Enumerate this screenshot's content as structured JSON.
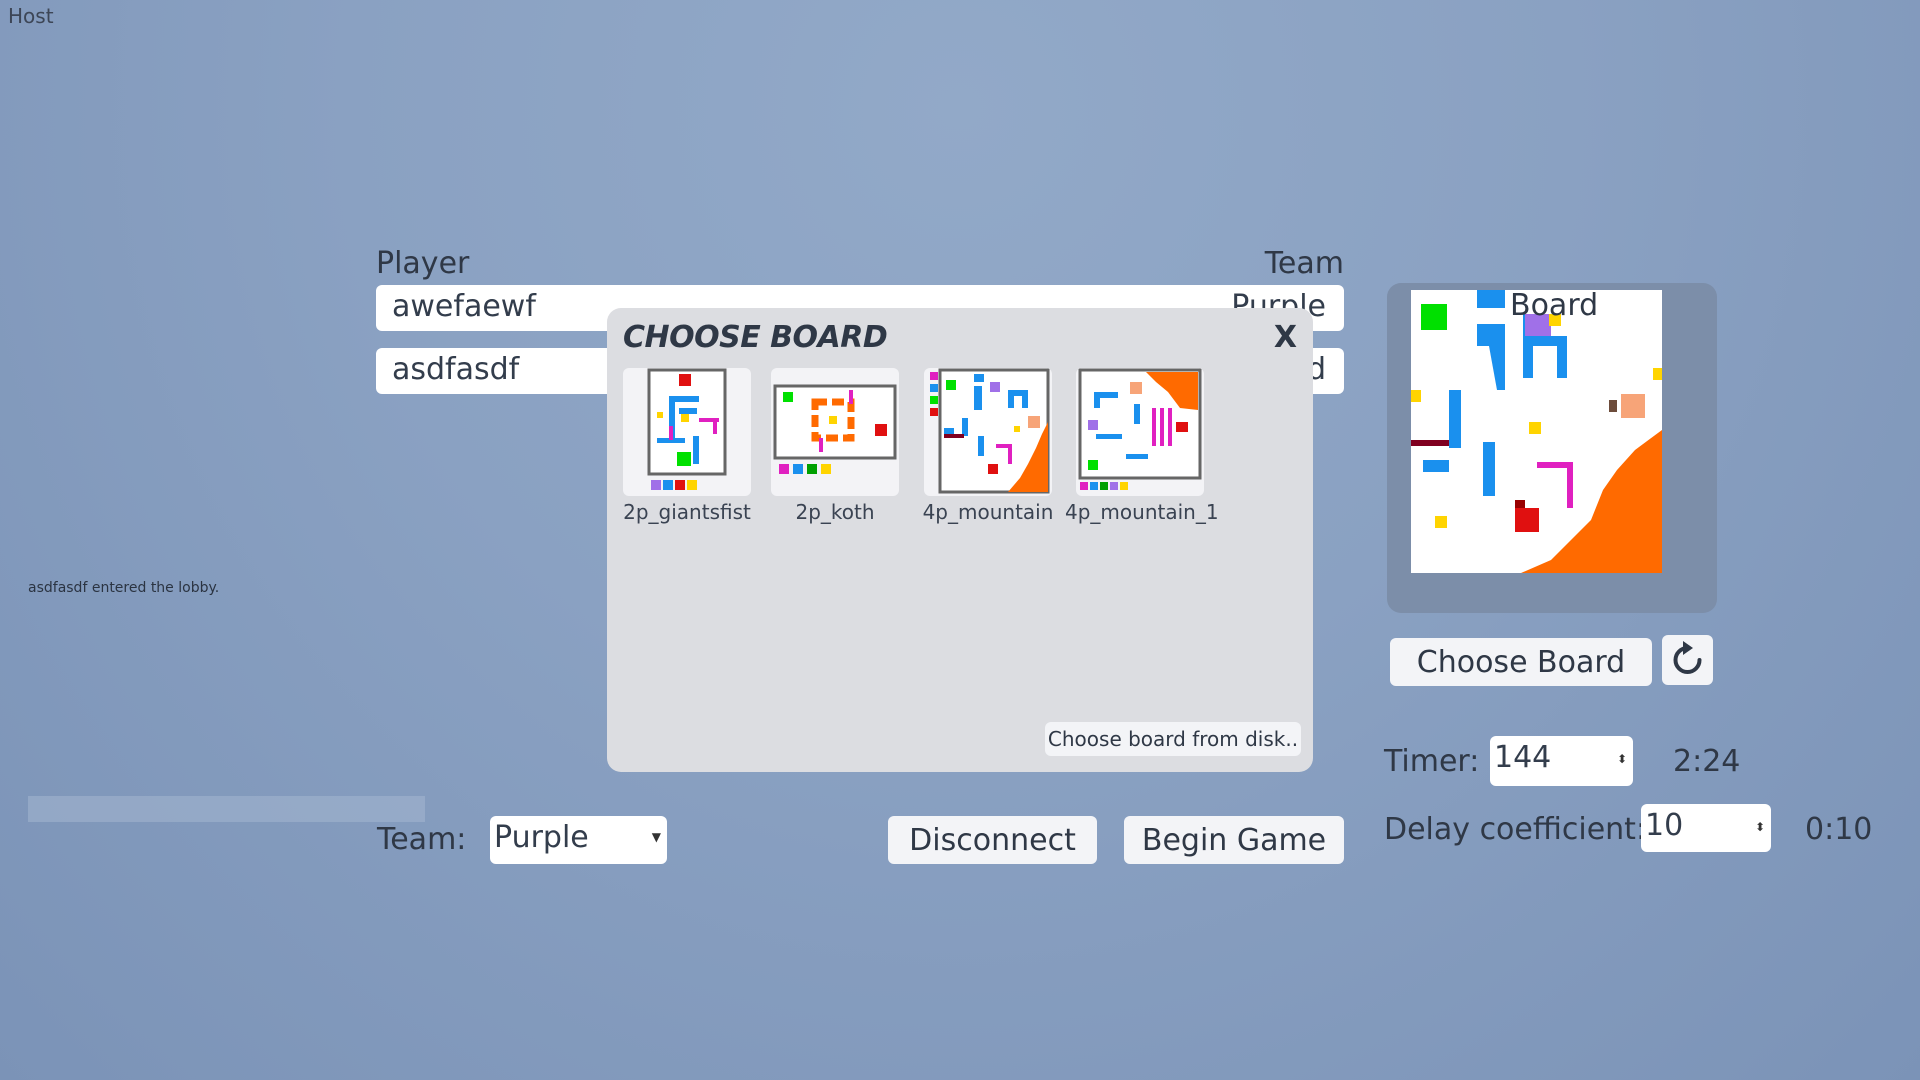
{
  "host_label": "Host",
  "players_table": {
    "player_header": "Player",
    "team_header": "Team",
    "rows": [
      {
        "name": "awefaewf",
        "team": "Purple"
      },
      {
        "name": "asdfasdf",
        "team": "d"
      }
    ]
  },
  "log": {
    "message": "asdfasdf entered the lobby."
  },
  "team_select": {
    "label": "Team:",
    "value": "Purple"
  },
  "buttons": {
    "disconnect": "Disconnect",
    "begin_game": "Begin Game",
    "choose_board": "Choose Board"
  },
  "board_panel": {
    "title": "Board"
  },
  "timer": {
    "label": "Timer:",
    "value": "144",
    "display": "2:24"
  },
  "delay": {
    "label": "Delay coefficient:",
    "value": "10",
    "display": "0:10"
  },
  "modal": {
    "title": "CHOOSE BOARD",
    "close_label": "X",
    "boards": [
      {
        "name": "2p_giantsfist"
      },
      {
        "name": "2p_koth"
      },
      {
        "name": "4p_mountain"
      },
      {
        "name": "4p_mountain_1"
      }
    ],
    "disk_button": "Choose board from disk.."
  },
  "colors": {
    "background": "#8aa1c2",
    "modal_bg": "#dcdde1",
    "board_panel_bg": "#7c8ea9",
    "green": "#00e000",
    "blue": "#1a90ee",
    "purple": "#a070e8",
    "yellow": "#ffd400",
    "red": "#e01010",
    "orange": "#ff6a00",
    "magenta": "#e020c0",
    "peach": "#f7a478"
  }
}
